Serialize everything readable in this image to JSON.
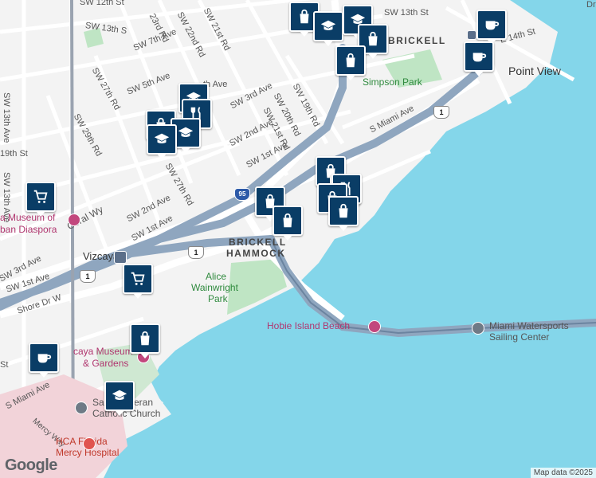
{
  "streets": [
    {
      "id": "sw-12th-st",
      "text": "SW 12th St"
    },
    {
      "id": "sw-13th-st-top",
      "text": "SW 13th St"
    },
    {
      "id": "sw-13th-st-left",
      "text": "SW 13th S"
    },
    {
      "id": "sw-23rd-rd",
      "text": "23rd Rd"
    },
    {
      "id": "sw-22nd-rd",
      "text": "SW 22nd Rd"
    },
    {
      "id": "sw-21st-rd-top",
      "text": "SW 21st Rd"
    },
    {
      "id": "sw-7th-ave",
      "text": "SW 7th Ave"
    },
    {
      "id": "sw-27th-rd-a",
      "text": "SW 27th Rd"
    },
    {
      "id": "sw-5th-ave",
      "text": "SW 5th Ave"
    },
    {
      "id": "sw-29th-rd",
      "text": "SW 29th Rd"
    },
    {
      "id": "sw-13th-ave-a",
      "text": "SW 13th Ave"
    },
    {
      "id": "sw-13th-ave-b",
      "text": "SW 13th Ave"
    },
    {
      "id": "sw-3rd-ave-mid",
      "text": "SW 3rd Ave"
    },
    {
      "id": "sw-19th-rd",
      "text": "SW 19th Rd"
    },
    {
      "id": "sw-20th-rd",
      "text": "SW 20th Rd"
    },
    {
      "id": "sw-21st-rd",
      "text": "SW 21st Rd"
    },
    {
      "id": "sw-2nd-ave-mid",
      "text": "SW 2nd Ave"
    },
    {
      "id": "sw-1st-ave-mid",
      "text": "SW 1st Ave"
    },
    {
      "id": "sw-27th-rd-b",
      "text": "SW 27th Rd"
    },
    {
      "id": "sw-2nd-ave-low",
      "text": "SW 2nd Ave"
    },
    {
      "id": "sw-1st-ave-low",
      "text": "SW 1st Ave"
    },
    {
      "id": "coral-way",
      "text": "Coral Wy"
    },
    {
      "id": "sw-3rd-ave-left",
      "text": "SW 3rd Ave"
    },
    {
      "id": "sw-1st-ave-left",
      "text": "SW 1st Ave"
    },
    {
      "id": "sw-19th-st",
      "text": "19th St"
    },
    {
      "id": "shore-dr-w",
      "text": "Shore Dr W"
    },
    {
      "id": "s-miami-ave-top",
      "text": "S Miami Ave"
    },
    {
      "id": "s-miami-ave-low",
      "text": "S Miami Ave"
    },
    {
      "id": "sw-th-ave",
      "text": "th Ave"
    },
    {
      "id": "mercy-way",
      "text": "Mercy Way"
    },
    {
      "id": "se-14th-st",
      "text": "E 14th St"
    },
    {
      "id": "st-frag",
      "text": "St"
    },
    {
      "id": "dr-frag",
      "text": "Dr"
    }
  ],
  "places": {
    "brickell": "BRICKELL",
    "point_view": "Point View",
    "simpson_park": "Simpson Park",
    "brickell_hammock_1": "BRICKELL",
    "brickell_hammock_2": "HAMMOCK",
    "vizcaya": "Vizcaya",
    "alice_1": "Alice",
    "alice_2": "Wainwright",
    "alice_3": "Park",
    "hobie": "Hobie Island Beach",
    "watersports_1": "Miami Watersports",
    "watersports_2": "Sailing Center",
    "museum_1": "a Museum of",
    "museum_2": "ban Diaspora",
    "vizcaya_museum_1": "caya Museum",
    "vizcaya_museum_2": "& Gardens",
    "church_1": "Sa",
    "church_2": "eran",
    "church_3": "Catholic Church",
    "hospital_1": "HCA Florida",
    "hospital_2": "Mercy Hospital"
  },
  "shields": [
    {
      "id": "us1-a",
      "text": "1"
    },
    {
      "id": "us1-b",
      "text": "1"
    },
    {
      "id": "us1-c",
      "text": "1"
    },
    {
      "id": "i95",
      "text": "95"
    }
  ],
  "markers": [
    {
      "id": "m1",
      "icon": "shopping-bag-icon"
    },
    {
      "id": "m2",
      "icon": "graduation-cap-icon"
    },
    {
      "id": "m3",
      "icon": "graduation-cap-icon"
    },
    {
      "id": "m4",
      "icon": "shopping-bag-icon"
    },
    {
      "id": "m5",
      "icon": "shopping-bag-icon"
    },
    {
      "id": "m6",
      "icon": "coffee-cup-icon"
    },
    {
      "id": "m7",
      "icon": "coffee-cup-icon"
    },
    {
      "id": "m8",
      "icon": "shopping-bag-icon"
    },
    {
      "id": "m9",
      "icon": "shopping-bag-icon"
    },
    {
      "id": "m10",
      "icon": "graduation-cap-icon"
    },
    {
      "id": "m11",
      "icon": "restaurant-icon"
    },
    {
      "id": "m12",
      "icon": "shopping-bag-icon"
    },
    {
      "id": "m13",
      "icon": "graduation-cap-icon"
    },
    {
      "id": "m14",
      "icon": "graduation-cap-icon"
    },
    {
      "id": "m15",
      "icon": "shopping-cart-icon"
    },
    {
      "id": "m16",
      "icon": "shopping-bag-icon"
    },
    {
      "id": "m17",
      "icon": "restaurant-icon"
    },
    {
      "id": "m18",
      "icon": "shopping-bag-icon"
    },
    {
      "id": "m19",
      "icon": "shopping-bag-icon"
    },
    {
      "id": "m20",
      "icon": "shopping-bag-icon"
    },
    {
      "id": "m21",
      "icon": "shopping-cart-icon"
    },
    {
      "id": "m22",
      "icon": "shopping-bag-icon"
    },
    {
      "id": "m23",
      "icon": "coffee-cup-icon"
    },
    {
      "id": "m24",
      "icon": "graduation-cap-icon"
    }
  ],
  "branding": {
    "google": "Google",
    "attribution": "Map data ©2025"
  },
  "colors": {
    "water": "#84d6ea",
    "land": "#f3f3f3",
    "park": "#bfe5c4",
    "highway": "#8fa6bf",
    "marker": "#0a3d66"
  }
}
